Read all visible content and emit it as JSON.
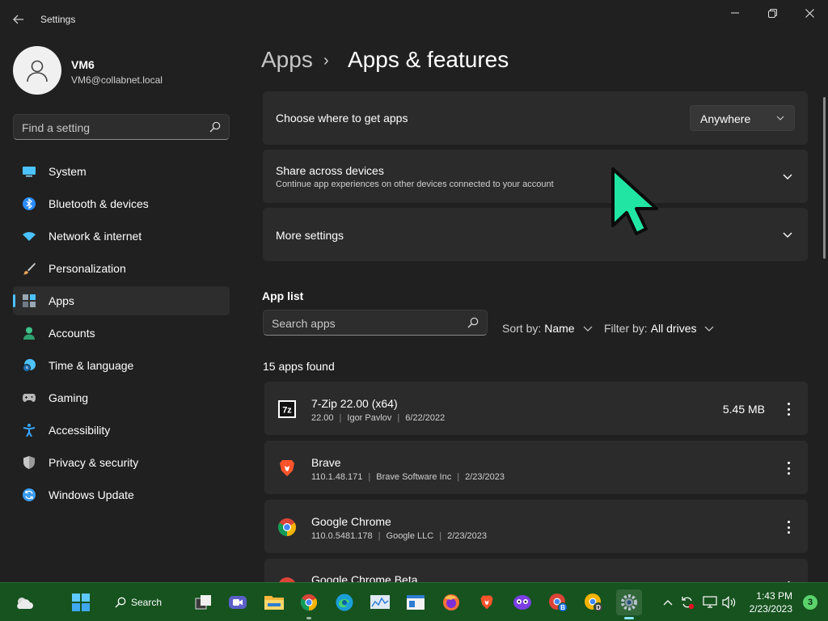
{
  "window": {
    "title": "Settings",
    "controls": {
      "minimize": "—",
      "maximize": "❐",
      "close": "✕"
    }
  },
  "user": {
    "name": "VM6",
    "email": "VM6@collabnet.local"
  },
  "sidebar": {
    "search_placeholder": "Find a setting",
    "items": [
      {
        "label": "System",
        "icon": "system-icon",
        "color": "#4cc2ff"
      },
      {
        "label": "Bluetooth & devices",
        "icon": "bluetooth-icon",
        "color": "#2a8cff"
      },
      {
        "label": "Network & internet",
        "icon": "wifi-icon",
        "color": "#4cc2ff"
      },
      {
        "label": "Personalization",
        "icon": "brush-icon",
        "color": "#e8a25a"
      },
      {
        "label": "Apps",
        "icon": "apps-icon",
        "color": "#9aa6b2",
        "active": true
      },
      {
        "label": "Accounts",
        "icon": "person-icon",
        "color": "#3fc48a"
      },
      {
        "label": "Time & language",
        "icon": "globe-clock-icon",
        "color": "#4cc2ff"
      },
      {
        "label": "Gaming",
        "icon": "gamepad-icon",
        "color": "#b8b8b8"
      },
      {
        "label": "Accessibility",
        "icon": "accessibility-icon",
        "color": "#38a5ff"
      },
      {
        "label": "Privacy & security",
        "icon": "shield-icon",
        "color": "#9a9a9a"
      },
      {
        "label": "Windows Update",
        "icon": "update-icon",
        "color": "#3a9cf0"
      }
    ]
  },
  "breadcrumb": {
    "parent": "Apps",
    "separator": "›",
    "current": "Apps & features"
  },
  "cards": {
    "choose_where": {
      "title": "Choose where to get apps",
      "dropdown_value": "Anywhere"
    },
    "share": {
      "title": "Share across devices",
      "subtitle": "Continue app experiences on other devices connected to your account"
    },
    "more": {
      "title": "More settings"
    }
  },
  "app_list": {
    "title": "App list",
    "search_placeholder": "Search apps",
    "sort_label": "Sort by:",
    "sort_value": "Name",
    "filter_label": "Filter by:",
    "filter_value": "All drives",
    "count_text": "15 apps found",
    "apps": [
      {
        "name": "7-Zip 22.00 (x64)",
        "version": "22.00",
        "publisher": "Igor Pavlov",
        "date": "6/22/2022",
        "size": "5.45 MB",
        "icon": "7zip-icon"
      },
      {
        "name": "Brave",
        "version": "110.1.48.171",
        "publisher": "Brave Software Inc",
        "date": "2/23/2023",
        "size": "",
        "icon": "brave-icon"
      },
      {
        "name": "Google Chrome",
        "version": "110.0.5481.178",
        "publisher": "Google LLC",
        "date": "2/23/2023",
        "size": "",
        "icon": "chrome-icon"
      },
      {
        "name": "Google Chrome Beta",
        "version": "",
        "publisher": "",
        "date": "",
        "size": "",
        "icon": "chrome-beta-icon"
      }
    ]
  },
  "taskbar": {
    "search_label": "Search",
    "apps": [
      "weather-icon",
      "start-icon",
      "task-view-icon",
      "meet-icon",
      "file-explorer-icon",
      "chrome-icon",
      "edge-icon",
      "perfmon-icon",
      "app-window-icon",
      "firefox-icon",
      "brave-icon",
      "privacy-icon",
      "chrome-beta-icon",
      "chrome-dev-icon",
      "settings-icon"
    ],
    "tray": [
      "chevron-up-icon",
      "sync-icon",
      "display-icon",
      "volume-icon"
    ],
    "time": "1:43 PM",
    "date": "2/23/2023",
    "notifications": "3"
  },
  "accent": "#4cc2ff",
  "cursor_color": "#21e6a3"
}
